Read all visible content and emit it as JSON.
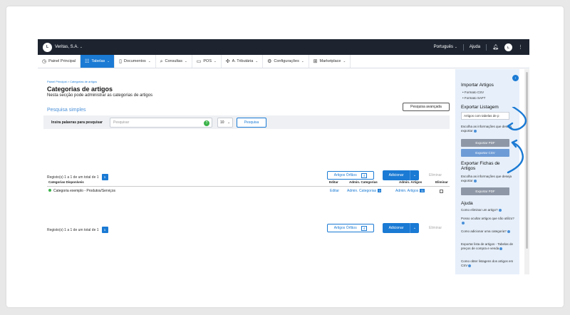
{
  "topbar": {
    "company": "Veritas, S.A.",
    "logo_text": "L",
    "language": "Português",
    "help": "Ajuda",
    "avatar": "L"
  },
  "nav": [
    {
      "label": "Painel Principal",
      "icon": "clock-icon",
      "glyph": "◷",
      "caret": false,
      "active": false
    },
    {
      "label": "Tabelas",
      "icon": "users-icon",
      "glyph": "☷",
      "caret": true,
      "active": true
    },
    {
      "label": "Documentos",
      "icon": "document-icon",
      "glyph": "▯",
      "caret": true,
      "active": false
    },
    {
      "label": "Consultas",
      "icon": "search-icon",
      "glyph": "⌕",
      "caret": true,
      "active": false
    },
    {
      "label": "POS",
      "icon": "pos-icon",
      "glyph": "▭",
      "caret": true,
      "active": false
    },
    {
      "label": "A. Tributária",
      "icon": "tax-icon",
      "glyph": "✣",
      "caret": true,
      "active": false
    },
    {
      "label": "Configurações",
      "icon": "settings-icon",
      "glyph": "⚙",
      "caret": true,
      "active": false
    },
    {
      "label": "Marketplace",
      "icon": "marketplace-icon",
      "glyph": "⊞",
      "caret": true,
      "active": false
    }
  ],
  "main": {
    "breadcrumb": "Painel Principal > Categorias de artigos",
    "title": "Categorias de artigos",
    "subtitle": "Nesta secção pode administrar as categorias de artigos",
    "advanced_search": "Pesquisa avançada",
    "simple_search": "Pesquisa simples",
    "search_label": "Insira palavras para pesquisar",
    "search_placeholder": "Pesquisar",
    "search_help": "?",
    "page_size": "10",
    "search_button": "Pesquisa",
    "records_text": "Registo(s) 1 a 1 de um total de 1",
    "page_number": "1",
    "orphans_label": "Artigos Órfãos",
    "orphans_count": "4",
    "add_label": "Adicionar",
    "delete_label": "Eliminar",
    "columns": {
      "category": "Categorias Disponíveis",
      "edit": "Editar",
      "admin_categories": "Admin. Categorias",
      "admin_items": "Admin. Artigos",
      "delete": "Eliminar"
    },
    "rows": [
      {
        "category": "Categoria exemplo - Produtos/Serviços",
        "edit": "Editar",
        "admin_categories": "Admin. Categorias",
        "admin_categories_count": "0",
        "admin_items": "Admin. Artigos",
        "admin_items_count": "11"
      }
    ]
  },
  "sidebar": {
    "import_title": "Importar Artigos",
    "import_csv": "• Formato CSV",
    "import_saft": "• Formato SAFT",
    "export_list_title": "Exportar Listagem",
    "export_select": "Artigos com tabelas de p",
    "export_note": "Escolha as informações que deseja exportar",
    "export_pdf": "Exportar PDF",
    "export_csv": "Exportar CSV",
    "export_sheets_title": "Exportar Fichas de Artigos",
    "export_sheets_note": "Escolha as informações que deseja exportar",
    "export_sheets_pdf": "Exportar PDF",
    "help_title": "Ajuda",
    "help_links": [
      "Como eliminar um artigo?",
      "Posso ocultar artigos que não utilizo?",
      "Como adicionar uma categoria?",
      "Exportar lista de artigos - Tabelas de preços de compra e venda",
      "Como obter listagens dos artigos em CSV"
    ]
  },
  "colors": {
    "topbar": "#1d2430",
    "accent": "#1a7ad4",
    "sidebar": "#e6effa",
    "disabled_button": "#8e97a6"
  }
}
